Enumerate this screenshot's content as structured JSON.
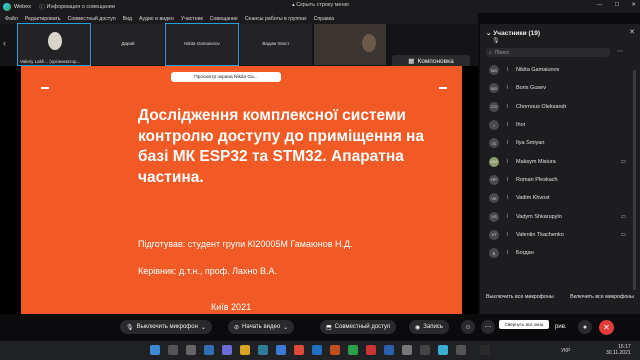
{
  "titlebar": {
    "app_name": "Webex",
    "info_label": "Информация о совещании",
    "hide_bar_label": "Скрыть строку меню"
  },
  "menu": [
    "Файл",
    "Редактировать",
    "Совместный доступ",
    "Вид",
    "Аудио и видео",
    "Участник",
    "Совещание",
    "Сеансы работы в группах",
    "Справка"
  ],
  "strip": {
    "tiles": [
      {
        "name": "",
        "bottom_label": "Valeriy Lakh... (организатор..."
      },
      {
        "name": "Дарий",
        "bottom_label": ""
      },
      {
        "name": "Nikita Gamaiunov",
        "bottom_label": ""
      },
      {
        "name": "Вадим Хвост",
        "bottom_label": ""
      }
    ],
    "layout_button": "Компоновка"
  },
  "viewing_banner": "Просмотр экрана Nikita Ga...",
  "slide": {
    "title": "Дослідження комплексної системи контролю доступу до приміщення на базі МК ESP32 та STM32. Апаратна частина.",
    "author": "Підготував: студент групи КІ20005М Гамаюнов Н.Д.",
    "supervisor": "Керівник:  д.т.н., проф.  Лахно В.А.",
    "city_year": "Київ 2021",
    "bg_color": "#f15a24"
  },
  "controls": {
    "mute": "Выключить микрофон",
    "video": "Начать видео",
    "share": "Совместный доступ",
    "record": "Запись",
    "tooltip": "Свернуть все окна",
    "participants_partial": "рив."
  },
  "participants_panel": {
    "title": "Участники (19)",
    "search_placeholder": "Поиск",
    "participants": [
      {
        "initials": "NG",
        "name": "Nikita Gamaiunov",
        "camera": false
      },
      {
        "initials": "BG",
        "name": "Boris Gusev",
        "camera": false
      },
      {
        "initials": "CO",
        "name": "Chornous Oleksandr",
        "camera": false
      },
      {
        "initials": "I",
        "name": "Ihor",
        "camera": false
      },
      {
        "initials": "IS",
        "name": "Ilya Smiyan",
        "camera": false
      },
      {
        "initials": "MM",
        "name": "Maksym Misiura",
        "camera": true
      },
      {
        "initials": "RP",
        "name": "Roman Pleskach",
        "camera": false
      },
      {
        "initials": "VK",
        "name": "Vadim Khvost",
        "camera": false
      },
      {
        "initials": "VS",
        "name": "Vadym Shkarupylo",
        "camera": true
      },
      {
        "initials": "VT",
        "name": "Valentin Tkachenko",
        "camera": true
      },
      {
        "initials": "Б",
        "name": "Богдан",
        "camera": false
      }
    ],
    "mute_all": "Выключить все микрофоны",
    "unmute_all": "Включить все микрофоны"
  },
  "taskbar": {
    "lang": "УКР",
    "time": "16:17",
    "date": "30.11.2021"
  }
}
